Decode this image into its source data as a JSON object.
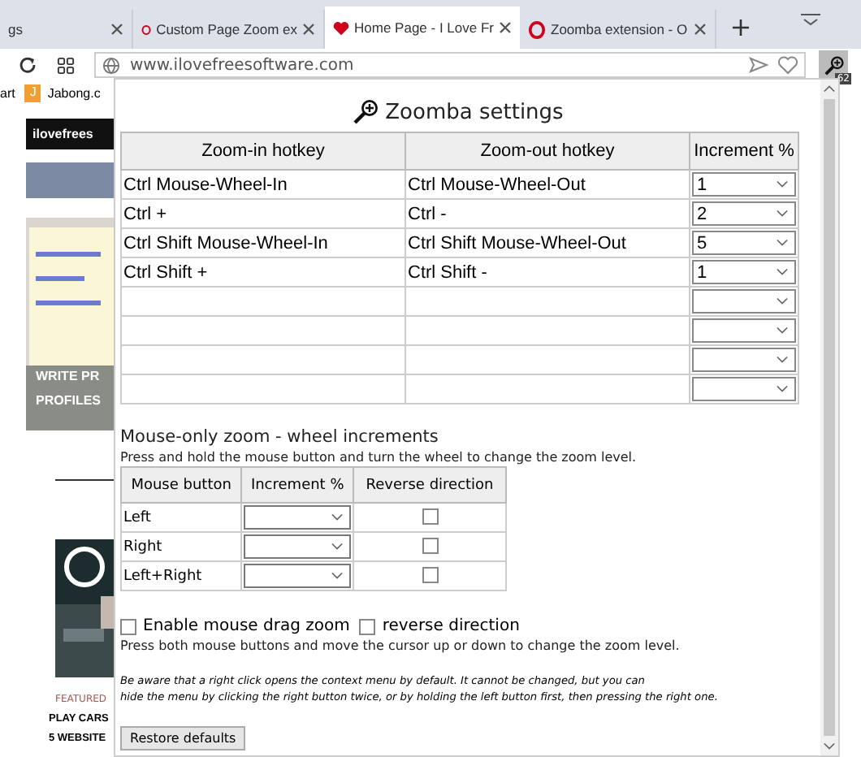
{
  "tabs": [
    {
      "label": "gs",
      "selected": false
    },
    {
      "label": "Custom Page Zoom ex",
      "selected": false
    },
    {
      "label": "Home Page - I Love Fr",
      "selected": true
    },
    {
      "label": "Zoomba extension - O",
      "selected": false
    }
  ],
  "address": {
    "value": "www.ilovefreesoftware.com",
    "badge": "62"
  },
  "bookmarks": [
    {
      "label": "art"
    },
    {
      "label": "Jabong.c",
      "letter": "J"
    }
  ],
  "page": {
    "logo": "ilovefrees",
    "banner_lines": [
      "WRITE PR",
      "PROFILES"
    ],
    "tag": "FEATURED",
    "headlines": [
      "PLAY CARS",
      "5 WEBSITE"
    ]
  },
  "popup": {
    "title": "Zoomba settings",
    "hotkeys": {
      "columns": [
        "Zoom-in hotkey",
        "Zoom-out hotkey",
        "Increment %"
      ],
      "rows": [
        {
          "zoom_in": "Ctrl Mouse-Wheel-In",
          "zoom_out": "Ctrl Mouse-Wheel-Out",
          "increment": "1"
        },
        {
          "zoom_in": "Ctrl +",
          "zoom_out": "Ctrl -",
          "increment": "2"
        },
        {
          "zoom_in": "Ctrl Shift Mouse-Wheel-In",
          "zoom_out": "Ctrl Shift Mouse-Wheel-Out",
          "increment": "5"
        },
        {
          "zoom_in": "Ctrl Shift +",
          "zoom_out": "Ctrl Shift -",
          "increment": "1"
        },
        {},
        {},
        {},
        {}
      ]
    },
    "mouse_heading": "Mouse-only zoom - wheel increments",
    "mouse_hint": "Press and hold the mouse button and turn the wheel to change the zoom level.",
    "mouse": {
      "columns": [
        "Mouse button",
        "Increment %",
        "Reverse direction"
      ],
      "rows": [
        {
          "button": "Left",
          "checked": false
        },
        {
          "button": "Right",
          "checked": false
        },
        {
          "button": "Left+Right",
          "checked": false
        }
      ]
    },
    "drag": {
      "label": "Enable mouse drag zoom",
      "checked": false
    },
    "reverse": {
      "label": "reverse direction",
      "checked": false
    },
    "drag_hint": "Press both mouse buttons and move the cursor up or down to change the zoom level.",
    "note_lines": [
      "Be aware that a right click opens the context menu by default. It cannot be changed, but you can",
      "hide the menu by clicking the right button twice, or by holding the left button first, then pressing the right one."
    ],
    "restore": "Restore defaults"
  }
}
